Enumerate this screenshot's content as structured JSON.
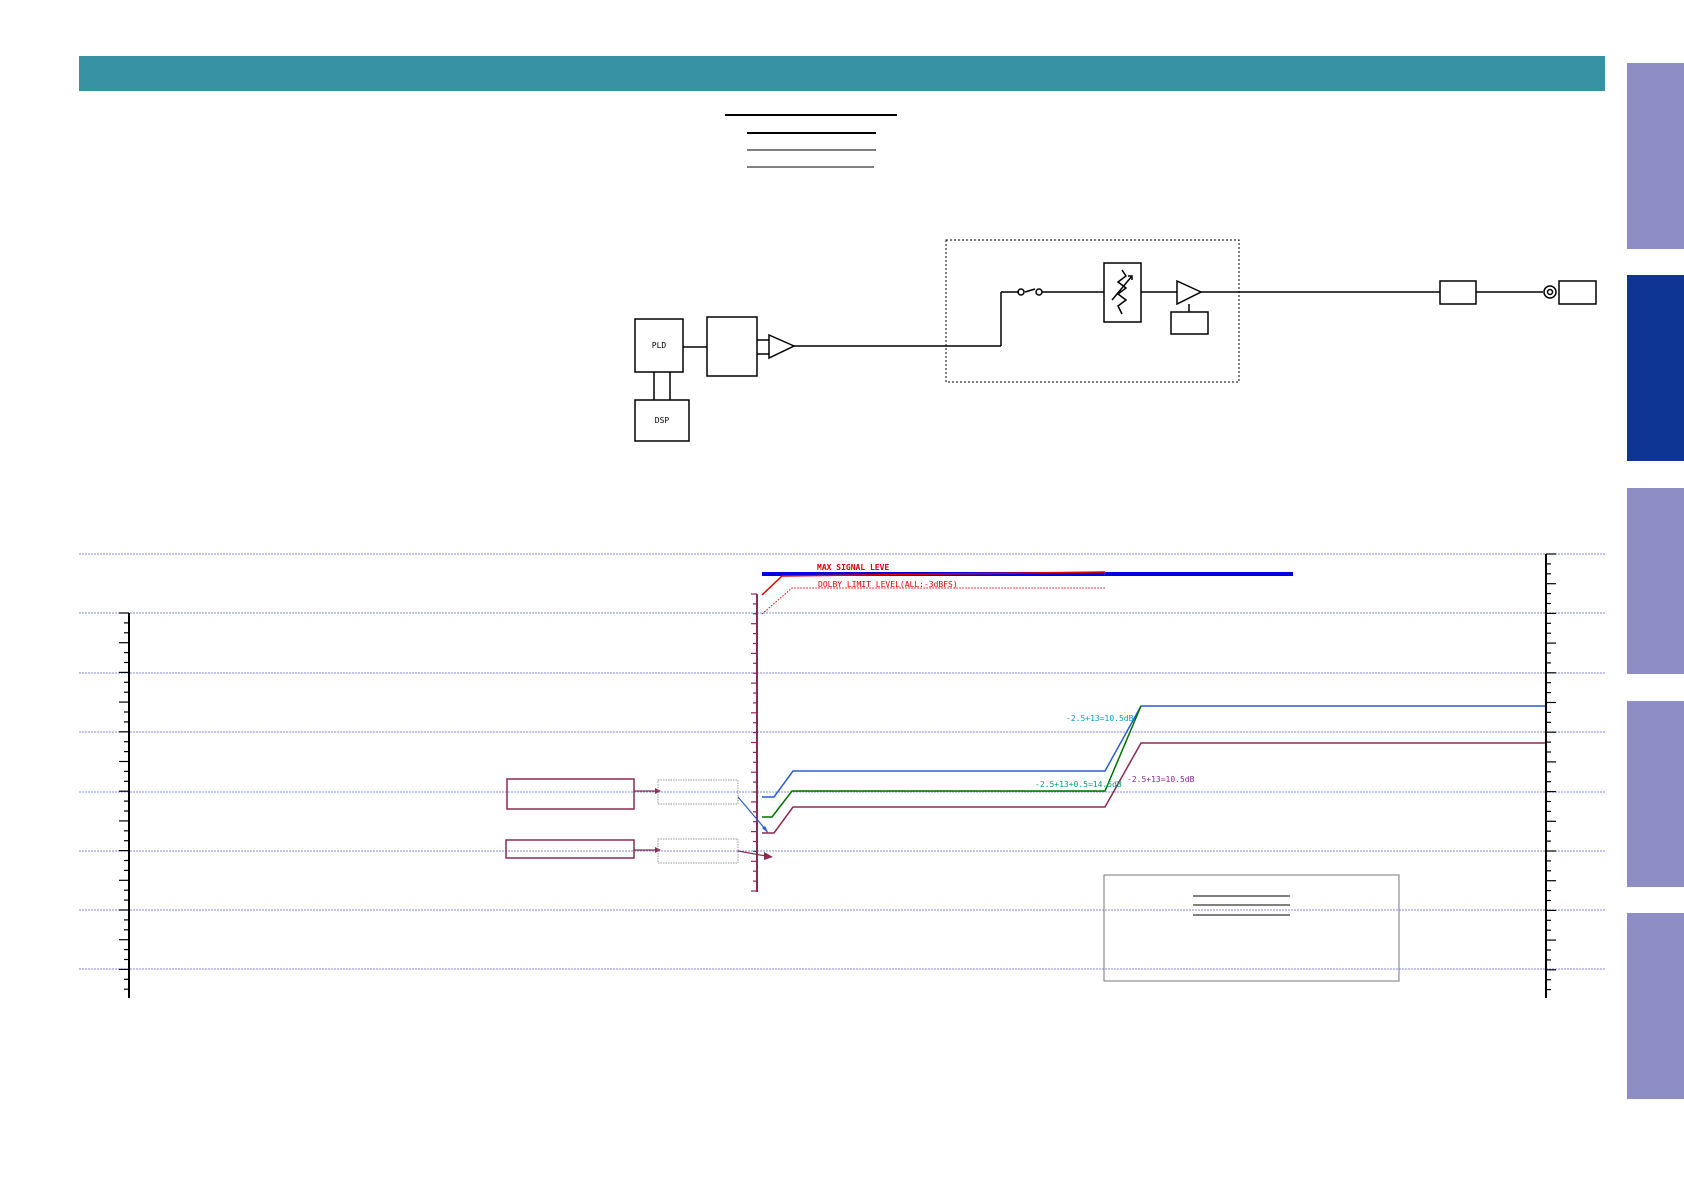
{
  "colors": {
    "header": "#3792a4",
    "tab_inactive": "#8e8ec4",
    "tab_active": "#0e3593",
    "grid": "#5a6ad6",
    "max_line": "#0000e0",
    "red": "#e00000",
    "blue_series": "#2a5fc8",
    "green_series": "#007000",
    "purple_series": "#8a2a55",
    "cyan_text": "#00a0c8",
    "green_text": "#00a070",
    "purple_text": "#8a2a8a"
  },
  "tabs": [
    {
      "active": false
    },
    {
      "active": true
    },
    {
      "active": false
    },
    {
      "active": false
    },
    {
      "active": false
    }
  ],
  "block": {
    "pld_label": "PLD",
    "dsp_label": "DSP"
  },
  "level": {
    "max_signal_label": "MAX SIGNAL LEVE",
    "dolby_limit_label": "DOLBY LIMIT LEVEL(ALL:-3dBFS)",
    "blue_gain_label": "-2.5+13=10.5dB",
    "green_gain_label": "-2.5+13+0.5=14.5dB",
    "purple_gain_label": "-2.5+13=10.5dB"
  }
}
